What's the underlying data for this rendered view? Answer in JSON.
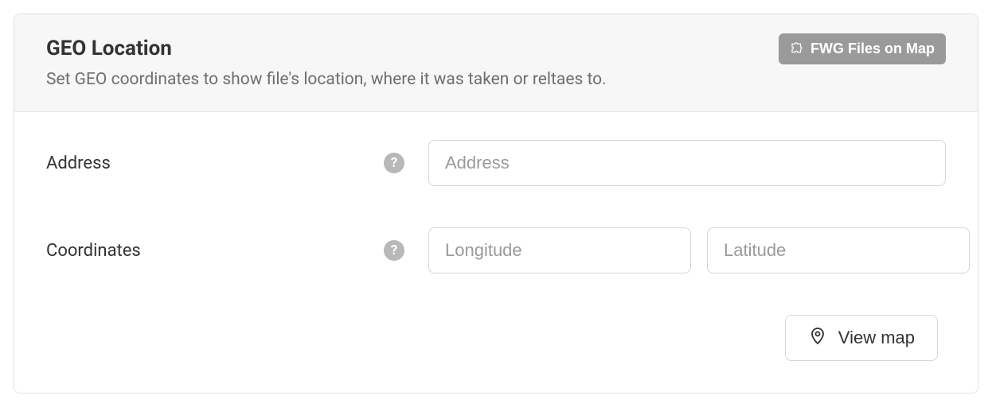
{
  "panel": {
    "title": "GEO Location",
    "subtitle": "Set GEO coordinates to show file's location, where it was taken or reltaes to.",
    "badge_label": "FWG Files on Map"
  },
  "form": {
    "address": {
      "label": "Address",
      "placeholder": "Address",
      "value": ""
    },
    "coordinates": {
      "label": "Coordinates",
      "longitude_placeholder": "Longitude",
      "longitude_value": "",
      "latitude_placeholder": "Latitude",
      "latitude_value": ""
    },
    "view_map_label": "View map"
  }
}
